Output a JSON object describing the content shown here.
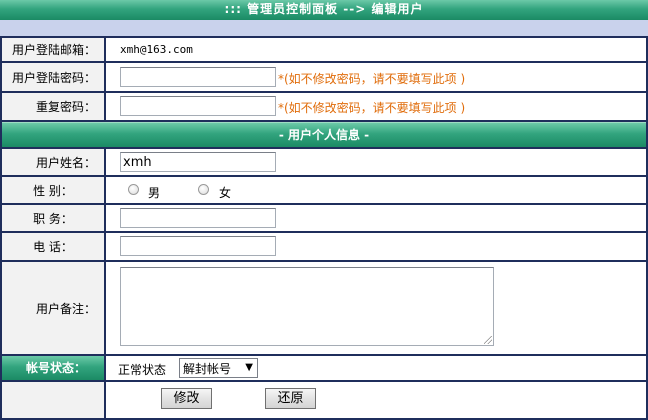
{
  "header": {
    "title": "::: 管理员控制面板 --> 编辑用户"
  },
  "form": {
    "email_label": "用户登陆邮箱：",
    "email_value": "xmh@163.com",
    "password_label": "用户登陆密码：",
    "password_value": "",
    "password_hint": "*(如不修改密码，请不要填写此项 )",
    "repeat_label": "重复密码：",
    "repeat_value": "",
    "repeat_hint": "*(如不修改密码，请不要填写此项 )",
    "section_title": "- 用户个人信息 -",
    "name_label": "用户姓名：",
    "name_value": "xmh",
    "gender_label": "性 别：",
    "gender_options": [
      "男",
      "女"
    ],
    "gender_selected": null,
    "position_label": "职 务：",
    "position_value": "",
    "phone_label": "电 话：",
    "phone_value": "",
    "remark_label": "用户备注：",
    "remark_value": "",
    "status_label": "帐号状态：",
    "status_text": "正常状态",
    "status_select_value": "解封帐号",
    "submit_label": "修改",
    "reset_label": "还原"
  },
  "colors": {
    "accent_green": "#32a47e",
    "hint_orange": "#e06c0a",
    "label_bg": "#f2f2f2",
    "border_navy": "#1f2e5c"
  }
}
